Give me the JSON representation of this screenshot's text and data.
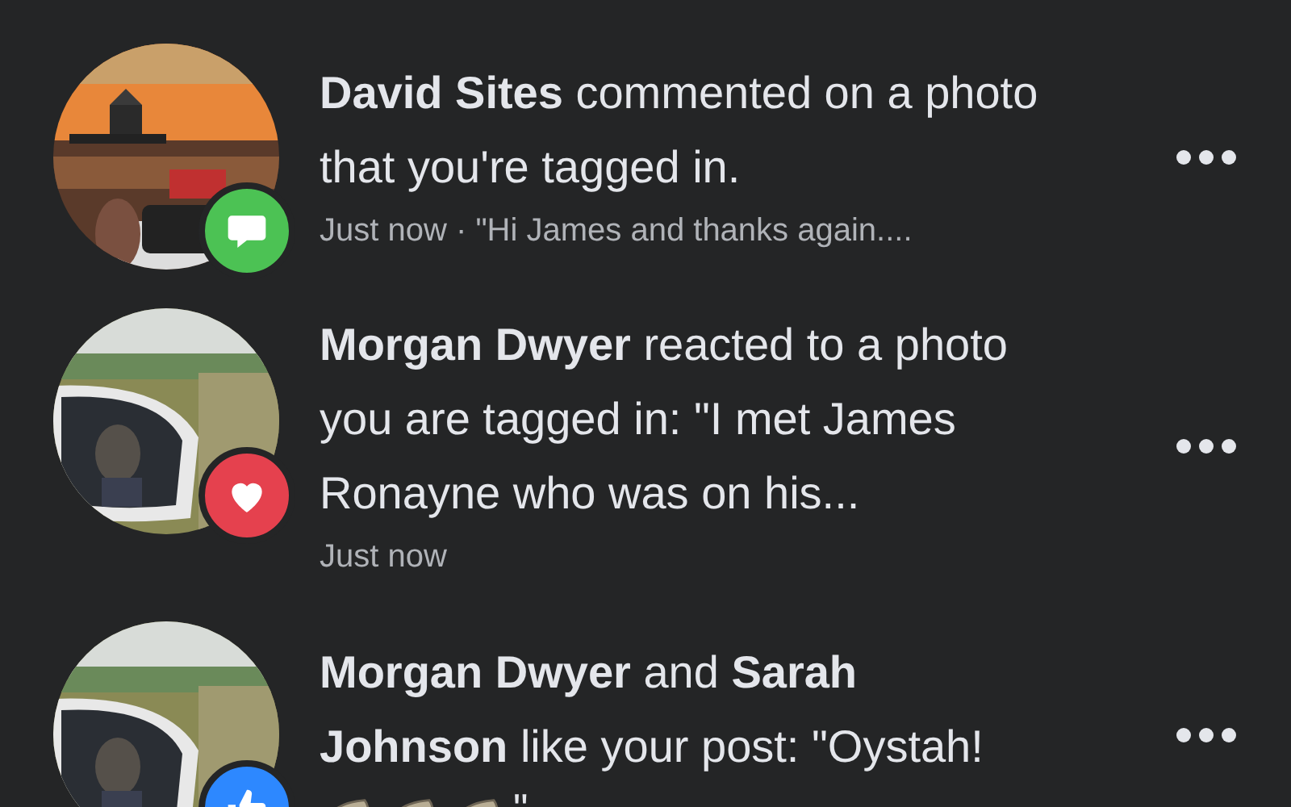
{
  "notifications": [
    {
      "kind": "comment",
      "message": "**David Sites** commented on a photo that you're tagged in.",
      "meta": "Just now · \"Hi James and thanks again...."
    },
    {
      "kind": "love",
      "message": "**Morgan Dwyer** reacted to a photo you are tagged in: \"I met James Ronayne who was on his...",
      "meta": "Just now"
    },
    {
      "kind": "like",
      "message": "**Morgan Dwyer** and **Sarah Johnson** like your post: \"Oystah!",
      "tail": "\""
    }
  ]
}
